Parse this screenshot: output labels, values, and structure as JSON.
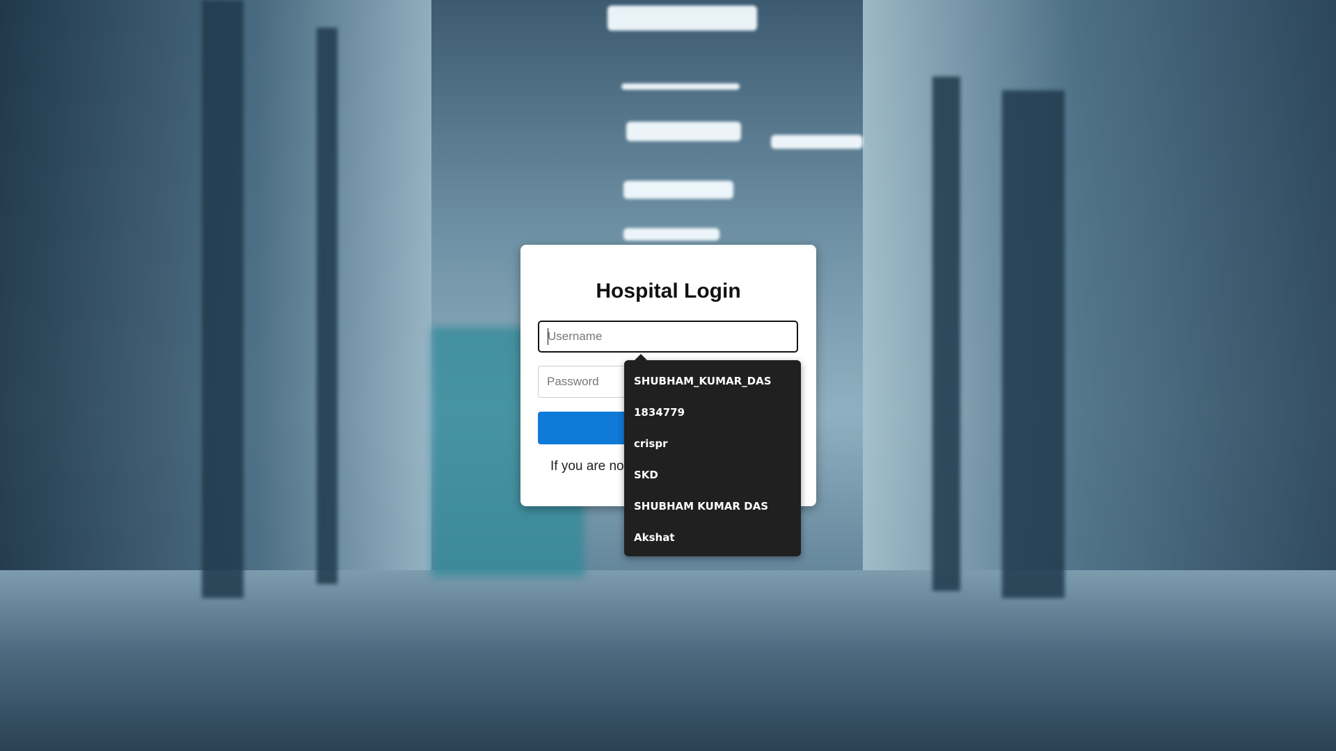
{
  "login": {
    "title": "Hospital Login",
    "username_placeholder": "Username",
    "password_placeholder": "Password",
    "login_button_label": "",
    "register_prefix": "If you are no",
    "register_link_label": ""
  },
  "autocomplete": {
    "items": [
      {
        "label": "SHUBHAM_KUMAR_DAS"
      },
      {
        "label": "1834779"
      },
      {
        "label": "crispr"
      },
      {
        "label": "SKD"
      },
      {
        "label": "SHUBHAM KUMAR DAS"
      },
      {
        "label": "Akshat"
      }
    ]
  },
  "colors": {
    "primary": "#0f7ad8",
    "dropdown_background": "#202020",
    "card_background": "#ffffff"
  }
}
